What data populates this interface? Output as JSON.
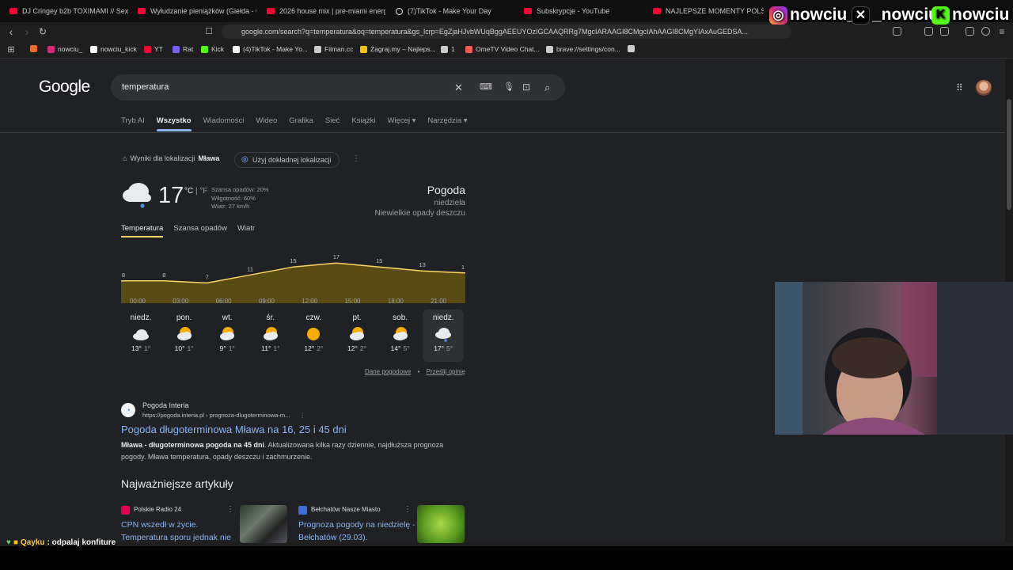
{
  "browser": {
    "tabs": [
      {
        "label": "DJ Cringey b2b TOXIMAMI // Sexpr",
        "icon": "youtube-icon"
      },
      {
        "label": "Wyłudzanie pieniążków (Giełda - Od",
        "icon": "youtube-icon"
      },
      {
        "label": "2026 house mix | pre-miami energy",
        "icon": "youtube-icon"
      },
      {
        "label": "(7)TikTok - Make Your Day",
        "icon": "tiktok-icon"
      },
      {
        "label": "Subskrypcje - YouTube",
        "icon": "youtube-icon"
      },
      {
        "label": "NAJLEPSZE MOMENTY POLSKIEGO",
        "icon": "youtube-icon"
      }
    ],
    "url": "google.com/search?q=temperatura&oq=temperatura&gs_lcrp=EgZjaHJvbWUqBggAEEUYOzIGCAAQRRg7MgcIARAAGI8CMgcIAhAAGI8CMgYIAxAuGEDSA...",
    "bookmarks": [
      {
        "label": "",
        "color": "#f06a2c"
      },
      {
        "label": "nowciu_",
        "color": "#d62976"
      },
      {
        "label": "nowciu_kick",
        "color": "#ffffff"
      },
      {
        "label": "YT",
        "color": "#ff0033"
      },
      {
        "label": "Rat",
        "color": "#7a5cff"
      },
      {
        "label": "Kick",
        "color": "#53fc18"
      },
      {
        "label": "(4)TikTok - Make Yo...",
        "color": "#ffffff"
      },
      {
        "label": "Filman.cc",
        "color": "#cccccc"
      },
      {
        "label": "Zagraj.my – Najleps...",
        "color": "#f4c20d"
      },
      {
        "label": "1",
        "color": "#cccccc"
      },
      {
        "label": "OmeTV Video Chat...",
        "color": "#ff5a5a"
      },
      {
        "label": "brave://settings/con...",
        "color": "#cccccc"
      },
      {
        "label": "",
        "color": "#cccccc"
      }
    ]
  },
  "overlay": {
    "handles": [
      {
        "label": "nowciu_",
        "icon": "instagram-icon"
      },
      {
        "label": "_nowciu",
        "icon": "x-icon"
      },
      {
        "label": "nowciu",
        "icon": "kick-icon"
      }
    ],
    "chat": {
      "user": "Qayku",
      "message": ": odpalaj konfiture"
    }
  },
  "google": {
    "logo": "Google",
    "query": "temperatura",
    "tabs": [
      "Tryb AI",
      "Wszystko",
      "Wiadomości",
      "Wideo",
      "Grafika",
      "Sieć",
      "Książki",
      "Więcej ▾",
      "Narzędzia ▾"
    ],
    "active_tab": "Wszystko"
  },
  "weather": {
    "location_prefix": "Wyniki dla lokalizacji",
    "location": "Mława",
    "precise_location_label": "Użyj dokładnej lokalizacji",
    "temperature": "17",
    "unit_c": "°C",
    "unit_sep": " | ",
    "unit_f": "°F",
    "precip": "Szansa opadów: 20%",
    "humidity": "Wilgotność: 60%",
    "wind": "Wiatr: 27 km/h",
    "title": "Pogoda",
    "day": "niedziela",
    "condition": "Niewielkie opady deszczu",
    "subtabs": [
      "Temperatura",
      "Szansa opadów",
      "Wiatr"
    ],
    "active_subtab": "Temperatura",
    "footer_link_1": "Dane pogodowe",
    "footer_sep": "•",
    "footer_link_2": "Prześlij opinię",
    "forecast": [
      {
        "day": "niedz.",
        "high": "13°",
        "low": "1°",
        "icon": "cloudy"
      },
      {
        "day": "pon.",
        "high": "10°",
        "low": "1°",
        "icon": "partly-cloudy"
      },
      {
        "day": "wt.",
        "high": "9°",
        "low": "1°",
        "icon": "partly-cloudy"
      },
      {
        "day": "śr.",
        "high": "11°",
        "low": "1°",
        "icon": "partly-cloudy"
      },
      {
        "day": "czw.",
        "high": "12°",
        "low": "2°",
        "icon": "sunny"
      },
      {
        "day": "pt.",
        "high": "12°",
        "low": "2°",
        "icon": "partly-cloudy"
      },
      {
        "day": "sob.",
        "high": "14°",
        "low": "5°",
        "icon": "partly-cloudy"
      },
      {
        "day": "niedz.",
        "high": "17°",
        "low": "5°",
        "icon": "rain"
      }
    ]
  },
  "chart_data": {
    "type": "area",
    "x": [
      "00:00",
      "03:00",
      "06:00",
      "09:00",
      "12:00",
      "15:00",
      "18:00",
      "21:00"
    ],
    "values": [
      8,
      8,
      7,
      11,
      15,
      17,
      15,
      13,
      1
    ],
    "point_labels": [
      "8",
      "8",
      "7",
      "11",
      "15",
      "17",
      "15",
      "13",
      "1"
    ],
    "color": "#fdd663",
    "fill": "#5a4a14"
  },
  "result": {
    "site": "Pogoda Interia",
    "url": "https://pogoda.interia.pl › prognoza-dlugoterminowa-m...",
    "title": "Pogoda długoterminowa Mława na 16, 25 i 45 dni",
    "snippet_bold": "Mława - długoterminowa pogoda na 45 dni",
    "snippet_rest": ". Aktualizowana kilka razy dziennie, najdłuższa prognoza pogody. Mława temperatura, opady deszczu i zachmurzenie."
  },
  "top_stories": {
    "heading": "Najważniejsze artykuły",
    "cards": [
      {
        "source": "Polskie Radio 24",
        "title": "CPN wszedł w życie. Temperatura sporu jednak nie",
        "color": "#e0004d"
      },
      {
        "source": "Bełchatów Nasze Miasto",
        "title": "Prognoza pogody na niedzielę - Bełchatów (29.03).",
        "color": "#3a6fd8"
      }
    ]
  }
}
